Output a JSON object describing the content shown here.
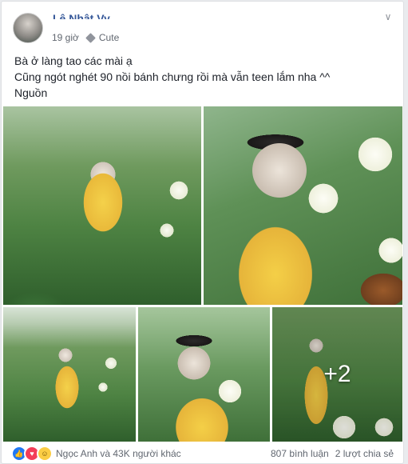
{
  "post": {
    "author": "Lê Nhật Vy",
    "time": "19 giờ",
    "audience": "Cute",
    "lines": [
      "Bà ở làng tao các mài ạ",
      "Cũng ngót nghét 90 nồi bánh chưng rồi mà vẫn teen lắm nha ^^",
      "Nguồn"
    ]
  },
  "photos": {
    "extra_count": "+2"
  },
  "reactions": {
    "summary": "Ngọc Anh và 43K người khác",
    "comments": "807 bình luận",
    "shares": "2 lượt chia sẻ"
  },
  "colors": {
    "link": "#365899",
    "like": "#2078f4",
    "love": "#f33e58",
    "haha": "#fbcd44"
  }
}
